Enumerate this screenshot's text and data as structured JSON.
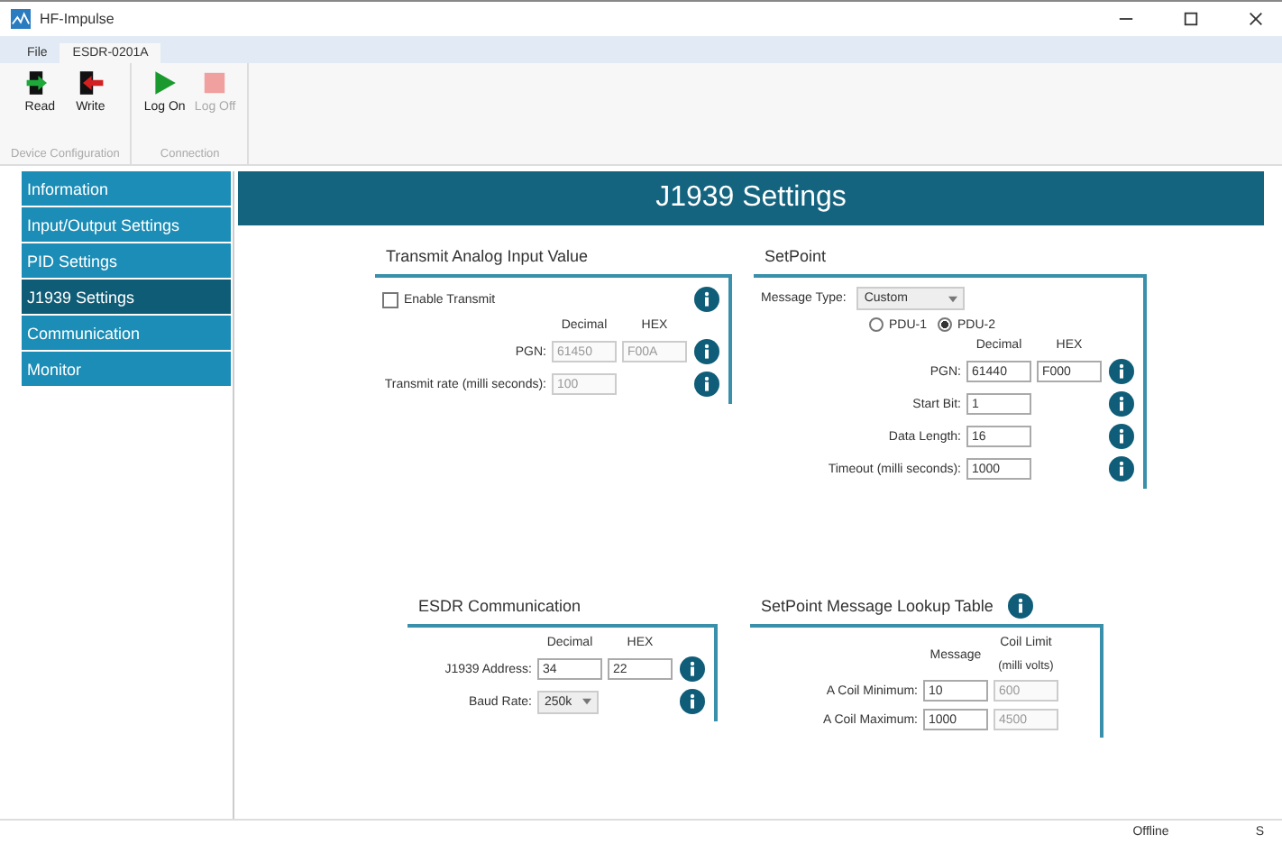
{
  "window": {
    "title": "HF-Impulse"
  },
  "menu_tabs": [
    {
      "label": "File",
      "selected": false
    },
    {
      "label": "ESDR-0201A",
      "selected": true
    }
  ],
  "ribbon": [
    {
      "label": "Device Configuration",
      "buttons": [
        {
          "label": "Read",
          "kind": "read",
          "disabled": false
        },
        {
          "label": "Write",
          "kind": "write",
          "disabled": false
        }
      ]
    },
    {
      "label": "Connection",
      "buttons": [
        {
          "label": "Log On",
          "kind": "start",
          "disabled": false
        },
        {
          "label": "Log Off",
          "kind": "stop",
          "disabled": true
        }
      ]
    }
  ],
  "sidebar": [
    {
      "label": "Information",
      "selected": false
    },
    {
      "label": "Input/Output Settings",
      "selected": false
    },
    {
      "label": "PID Settings",
      "selected": false
    },
    {
      "label": "J1939 Settings",
      "selected": true
    },
    {
      "label": "Communication",
      "selected": false
    },
    {
      "label": "Monitor",
      "selected": false
    }
  ],
  "page_title": "J1939 Settings",
  "panels": [
    {
      "title": "Transmit Analog Input Value",
      "rows": [
        {
          "kind": "checkbox",
          "label": "Enable Transmit",
          "checked": false,
          "info": true
        },
        {
          "kind": "headers",
          "headers": [
            {
              "text": "Decimal"
            },
            {
              "text": "HEX"
            }
          ]
        },
        {
          "kind": "fields",
          "label": "PGN:",
          "fields": [
            {
              "value": "61450",
              "disabled": true
            },
            {
              "value": "F00A",
              "disabled": true
            }
          ],
          "info": true
        },
        {
          "kind": "fields",
          "label": "Transmit rate (milli seconds):",
          "fields": [
            {
              "value": "100",
              "disabled": true
            }
          ],
          "info": true
        }
      ]
    },
    {
      "title": "SetPoint",
      "rows": [
        {
          "kind": "type-select",
          "label": "Message Type:",
          "value": "Custom"
        },
        {
          "kind": "radios",
          "options": [
            {
              "label": "PDU-1",
              "selected": false
            },
            {
              "label": "PDU-2",
              "selected": true
            }
          ]
        },
        {
          "kind": "headers",
          "headers": [
            {
              "text": "Decimal"
            },
            {
              "text": "HEX"
            }
          ]
        },
        {
          "kind": "fields",
          "label": "PGN:",
          "fields": [
            {
              "value": "61440",
              "disabled": false
            },
            {
              "value": "F000",
              "disabled": false
            }
          ],
          "info": true
        },
        {
          "kind": "fields",
          "label": "Start Bit:",
          "fields": [
            {
              "value": "1",
              "disabled": false
            }
          ],
          "info": true
        },
        {
          "kind": "fields",
          "label": "Data Length:",
          "fields": [
            {
              "value": "16",
              "disabled": false
            }
          ],
          "info": true
        },
        {
          "kind": "fields",
          "label": "Timeout (milli seconds):",
          "fields": [
            {
              "value": "1000",
              "disabled": false
            }
          ],
          "info": true
        }
      ]
    },
    {
      "title": "ESDR Communication",
      "rows": [
        {
          "kind": "headers",
          "headers": [
            {
              "text": "Decimal"
            },
            {
              "text": "HEX"
            }
          ]
        },
        {
          "kind": "fields",
          "label": "J1939 Address:",
          "fields": [
            {
              "value": "34",
              "disabled": false
            },
            {
              "value": "22",
              "disabled": false
            }
          ],
          "info": true
        },
        {
          "kind": "select",
          "label": "Baud Rate:",
          "value": "250k",
          "info": true
        }
      ]
    },
    {
      "title": "SetPoint Message Lookup Table",
      "title_info": true,
      "rows": [
        {
          "kind": "headers",
          "headers": [
            {
              "text": "Message"
            },
            {
              "text": "Coil Limit",
              "note": "(milli volts)"
            }
          ]
        },
        {
          "kind": "fields",
          "label": "A Coil Minimum:",
          "fields": [
            {
              "value": "10",
              "disabled": false
            },
            {
              "value": "600",
              "disabled": true
            }
          ]
        },
        {
          "kind": "fields",
          "label": "A Coil Maximum:",
          "fields": [
            {
              "value": "1000",
              "disabled": false
            },
            {
              "value": "4500",
              "disabled": true
            }
          ]
        }
      ]
    }
  ],
  "status_bar": [
    "Offline",
    "S"
  ]
}
